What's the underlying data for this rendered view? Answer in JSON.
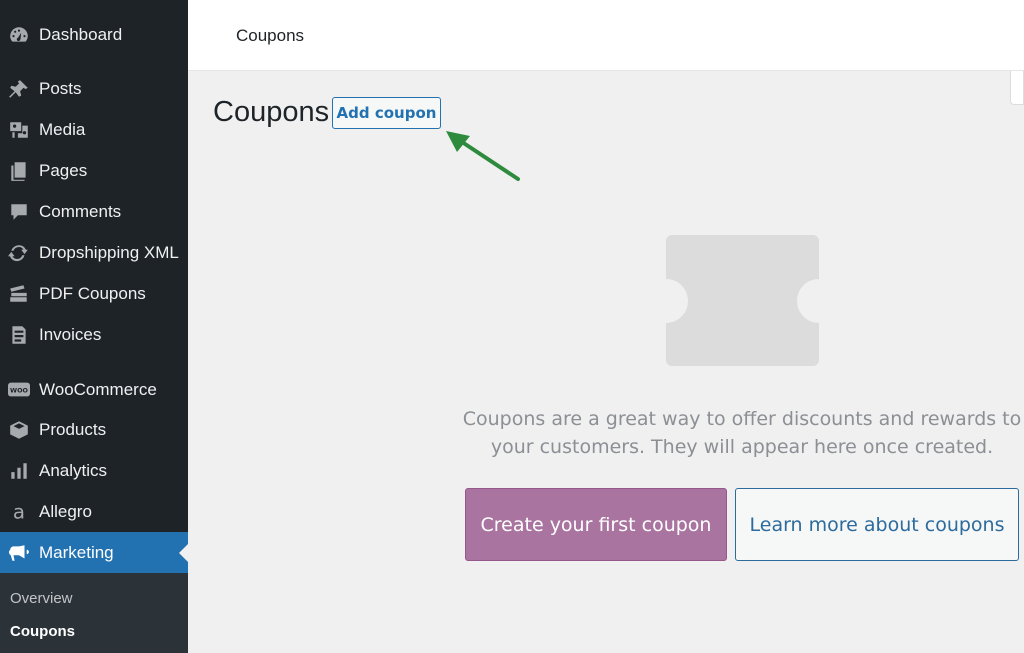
{
  "sidebar": {
    "items": [
      {
        "label": "Dashboard",
        "icon": "dashboard-icon"
      },
      {
        "label": "Posts",
        "icon": "pin-icon"
      },
      {
        "label": "Media",
        "icon": "media-icon"
      },
      {
        "label": "Pages",
        "icon": "pages-icon"
      },
      {
        "label": "Comments",
        "icon": "comment-icon"
      },
      {
        "label": "Dropshipping XML",
        "icon": "refresh-icon"
      },
      {
        "label": "PDF Coupons",
        "icon": "tickets-icon"
      },
      {
        "label": "Invoices",
        "icon": "invoice-icon"
      },
      {
        "label": "WooCommerce",
        "icon": "woo-icon"
      },
      {
        "label": "Products",
        "icon": "archive-icon"
      },
      {
        "label": "Analytics",
        "icon": "chart-bar-icon"
      },
      {
        "label": "Allegro",
        "icon": "allegro-icon"
      },
      {
        "label": "Marketing",
        "icon": "megaphone-icon"
      }
    ],
    "submenu": [
      {
        "label": "Overview"
      },
      {
        "label": "Coupons"
      }
    ],
    "active_color": "#2271b1"
  },
  "header": {
    "title": "Coupons"
  },
  "main": {
    "page_title": "Coupons",
    "add_button": "Add coupon",
    "empty_message": "Coupons are a great way to offer discounts and rewards to your customers. They will appear here once created.",
    "primary_button": "Create your first coupon",
    "secondary_button": "Learn more about coupons",
    "primary_color": "#a974a0",
    "arrow_color": "#2e8b3e"
  }
}
